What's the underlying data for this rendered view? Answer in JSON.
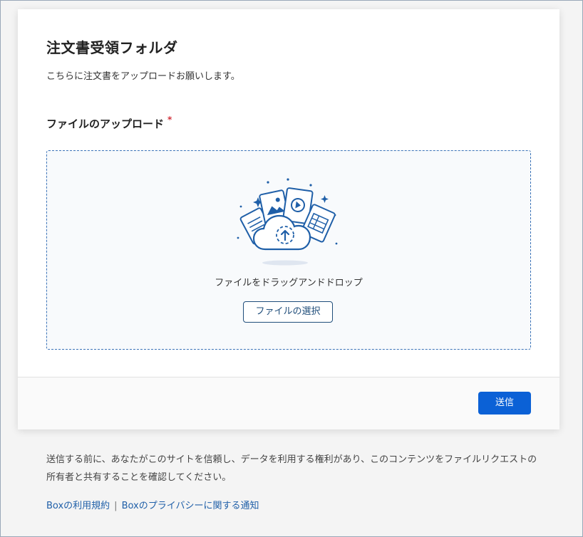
{
  "form": {
    "title": "注文書受領フォルダ",
    "description": "こちらに注文書をアップロードお願いします。",
    "upload_label": "ファイルのアップロード",
    "required_mark": "*",
    "dropzone": {
      "icon": "cloud-upload-documents-icon",
      "drop_text": "ファイルをドラッグアンドドロップ",
      "select_button_label": "ファイルの選択"
    },
    "submit_label": "送信"
  },
  "footer": {
    "notice": "送信する前に、あなたがこのサイトを信頼し、データを利用する権利があり、このコンテンツをファイルリクエストの所有者と共有することを確認してください。",
    "terms_link": "Boxの利用規約",
    "separator": "|",
    "privacy_link": "Boxのプライバシーに関する通知"
  },
  "colors": {
    "accent": "#0b61d6",
    "dropzone_border": "#3b73b8",
    "required": "#d2323c",
    "link": "#1f5fa8"
  }
}
